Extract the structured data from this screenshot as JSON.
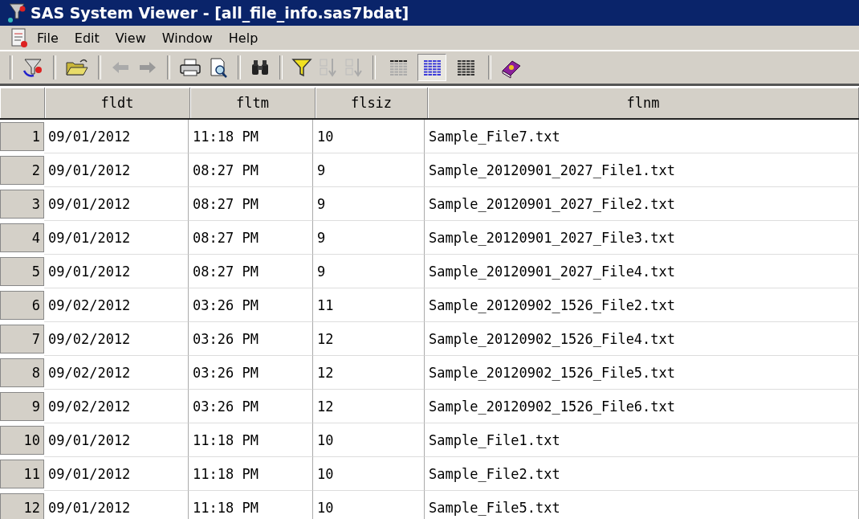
{
  "window": {
    "title": "SAS System Viewer - [all_file_info.sas7bdat]"
  },
  "menu": [
    "File",
    "Edit",
    "View",
    "Window",
    "Help"
  ],
  "toolbar": {
    "views": [
      {
        "selected": false
      },
      {
        "selected": true
      },
      {
        "selected": false
      }
    ]
  },
  "table": {
    "columns": [
      "fldt",
      "fltm",
      "flsiz",
      "flnm"
    ],
    "rows": [
      {
        "number": "1",
        "cells": [
          "09/01/2012",
          "11:18 PM",
          "10",
          "Sample_File7.txt"
        ]
      },
      {
        "number": "2",
        "cells": [
          "09/01/2012",
          "08:27 PM",
          "9",
          "Sample_20120901_2027_File1.txt"
        ]
      },
      {
        "number": "3",
        "cells": [
          "09/01/2012",
          "08:27 PM",
          "9",
          "Sample_20120901_2027_File2.txt"
        ]
      },
      {
        "number": "4",
        "cells": [
          "09/01/2012",
          "08:27 PM",
          "9",
          "Sample_20120901_2027_File3.txt"
        ]
      },
      {
        "number": "5",
        "cells": [
          "09/01/2012",
          "08:27 PM",
          "9",
          "Sample_20120901_2027_File4.txt"
        ]
      },
      {
        "number": "6",
        "cells": [
          "09/02/2012",
          "03:26 PM",
          "11",
          "Sample_20120902_1526_File2.txt"
        ]
      },
      {
        "number": "7",
        "cells": [
          "09/02/2012",
          "03:26 PM",
          "12",
          "Sample_20120902_1526_File4.txt"
        ]
      },
      {
        "number": "8",
        "cells": [
          "09/02/2012",
          "03:26 PM",
          "12",
          "Sample_20120902_1526_File5.txt"
        ]
      },
      {
        "number": "9",
        "cells": [
          "09/02/2012",
          "03:26 PM",
          "12",
          "Sample_20120902_1526_File6.txt"
        ]
      },
      {
        "number": "10",
        "cells": [
          "09/01/2012",
          "11:18 PM",
          "10",
          "Sample_File1.txt"
        ]
      },
      {
        "number": "11",
        "cells": [
          "09/01/2012",
          "11:18 PM",
          "10",
          "Sample_File2.txt"
        ]
      },
      {
        "number": "12",
        "cells": [
          "09/01/2012",
          "11:18 PM",
          "10",
          "Sample_File5.txt"
        ]
      }
    ]
  }
}
